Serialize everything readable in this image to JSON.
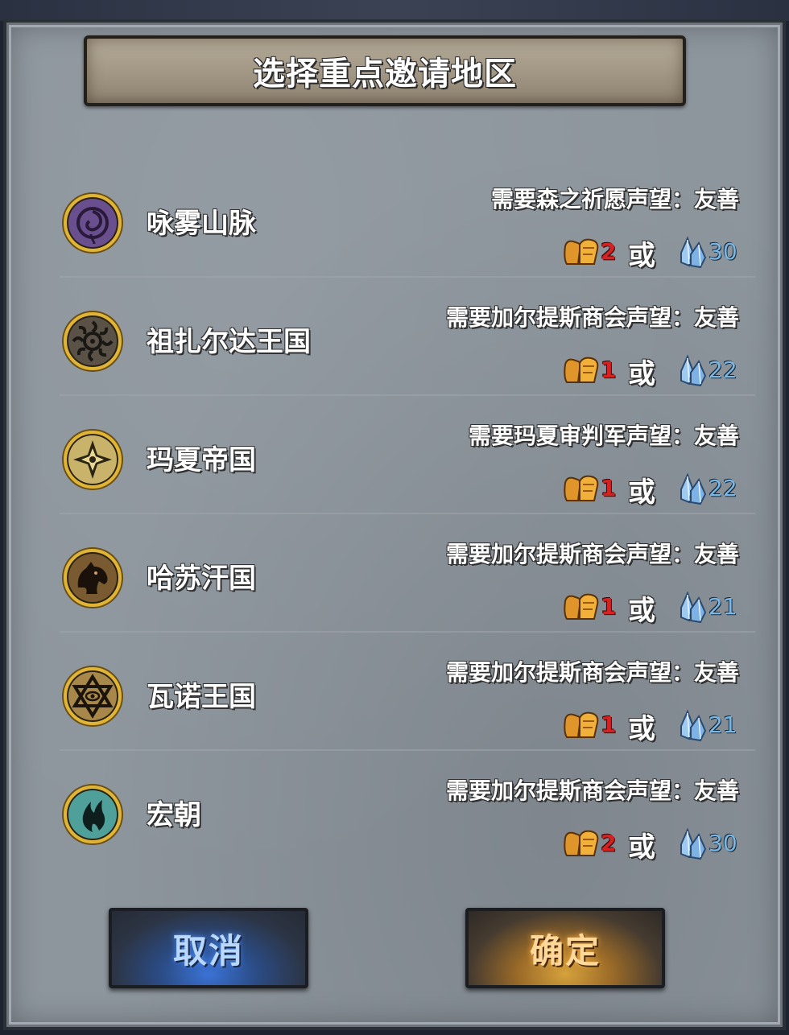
{
  "dialog": {
    "title": "选择重点邀请地区"
  },
  "regions": [
    {
      "name": "咏雾山脉",
      "requirement": "需要森之祈愿声望：友善",
      "emblem_icon": "spiral-mist-icon",
      "emblem_color": "#6a4f8f",
      "bread_count": "2",
      "or_label": "或",
      "crystal_count": "30"
    },
    {
      "name": "祖扎尔达王国",
      "requirement": "需要加尔提斯商会声望：友善",
      "emblem_icon": "sun-wheel-icon",
      "emblem_color": "#5a5246",
      "bread_count": "1",
      "or_label": "或",
      "crystal_count": "22"
    },
    {
      "name": "玛夏帝国",
      "requirement": "需要玛夏审判军声望：友善",
      "emblem_icon": "compass-cross-icon",
      "emblem_color": "#c9b36a",
      "bread_count": "1",
      "or_label": "或",
      "crystal_count": "22"
    },
    {
      "name": "哈苏汗国",
      "requirement": "需要加尔提斯商会声望：友善",
      "emblem_icon": "horse-head-icon",
      "emblem_color": "#7a5a30",
      "bread_count": "1",
      "or_label": "或",
      "crystal_count": "21"
    },
    {
      "name": "瓦诺王国",
      "requirement": "需要加尔提斯商会声望：友善",
      "emblem_icon": "hexagram-eye-icon",
      "emblem_color": "#a8884a",
      "bread_count": "1",
      "or_label": "或",
      "crystal_count": "21"
    },
    {
      "name": "宏朝",
      "requirement": "需要加尔提斯商会声望：友善",
      "emblem_icon": "phoenix-flame-icon",
      "emblem_color": "#4fa09a",
      "bread_count": "2",
      "or_label": "或",
      "crystal_count": "30"
    }
  ],
  "buttons": {
    "cancel_label": "取消",
    "confirm_label": "确定"
  },
  "colors": {
    "panel_bg": "#8d959d",
    "title_banner": "#a39885",
    "bread_count": "#d42222",
    "crystal_count": "#78b7e6",
    "cancel_glow": "#3b73d6",
    "confirm_glow": "#d6a23c"
  }
}
